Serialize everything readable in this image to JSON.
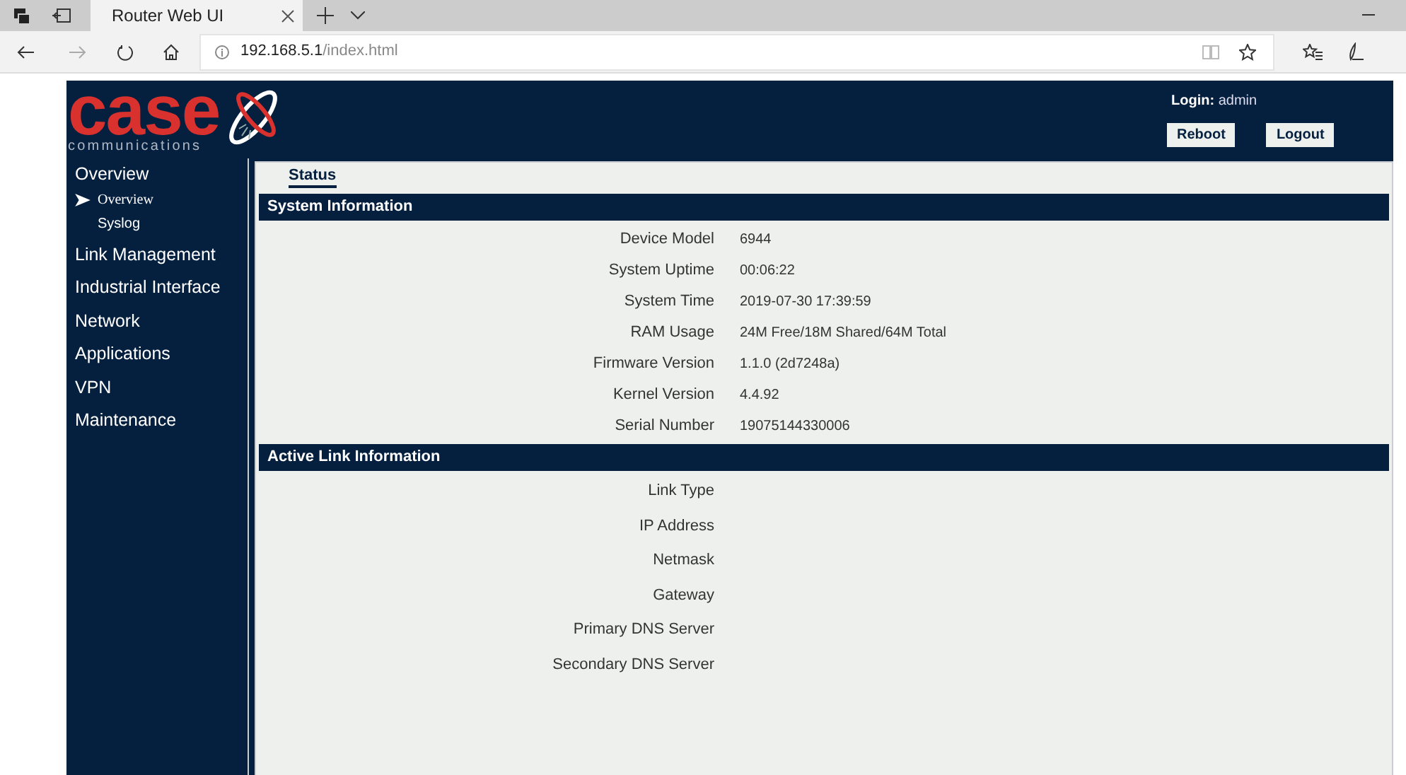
{
  "browser": {
    "tab": {
      "title": "Router Web UI"
    },
    "address": {
      "host": "192.168.5.1",
      "path": "/index.html"
    }
  },
  "header": {
    "logo": {
      "name": "case",
      "tagline": "communications"
    },
    "login_label": "Login:",
    "login_user": "admin",
    "buttons": [
      "Reboot",
      "Logout"
    ]
  },
  "sidebar": {
    "items": [
      {
        "label": "Overview",
        "children": [
          {
            "label": "Overview",
            "selected": true
          },
          {
            "label": "Syslog",
            "selected": false
          }
        ]
      },
      {
        "label": "Link Management"
      },
      {
        "label": "Industrial Interface"
      },
      {
        "label": "Network"
      },
      {
        "label": "Applications"
      },
      {
        "label": "VPN"
      },
      {
        "label": "Maintenance"
      }
    ]
  },
  "content": {
    "tabs": [
      {
        "label": "Status",
        "selected": true
      }
    ],
    "sections": [
      {
        "title": "System Information",
        "rows": [
          {
            "label": "Device Model",
            "value": "6944"
          },
          {
            "label": "System Uptime",
            "value": "00:06:22"
          },
          {
            "label": "System Time",
            "value": "2019-07-30 17:39:59"
          },
          {
            "label": "RAM Usage",
            "value": "24M Free/18M Shared/64M Total"
          },
          {
            "label": "Firmware Version",
            "value": "1.1.0 (2d7248a)"
          },
          {
            "label": "Kernel Version",
            "value": "4.4.92"
          },
          {
            "label": "Serial Number",
            "value": "19075144330006"
          }
        ]
      },
      {
        "title": "Active Link Information",
        "rows": [
          {
            "label": "Link Type"
          },
          {
            "label": "IP Address"
          },
          {
            "label": "Netmask"
          },
          {
            "label": "Gateway"
          },
          {
            "label": "Primary DNS Server"
          },
          {
            "label": "Secondary DNS Server"
          }
        ]
      }
    ]
  }
}
